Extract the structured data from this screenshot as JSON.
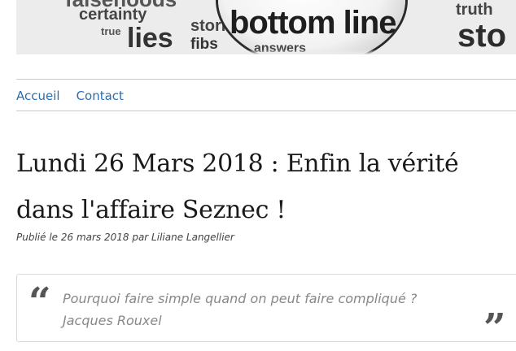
{
  "header": {
    "banner_words": [
      "certainty",
      "true",
      "lies",
      "stories",
      "fibs",
      "answers",
      "bottom line",
      "truth",
      "sto",
      "falsehoods"
    ]
  },
  "nav": {
    "items": [
      {
        "label": "Accueil"
      },
      {
        "label": "Contact"
      }
    ]
  },
  "article": {
    "title_line1": "Lundi 26 Mars 2018 : Enfin la vérité",
    "title_line2": "dans l'affaire Seznec !",
    "meta": "Publié le 26 mars 2018 par Liliane Langellier"
  },
  "quote": {
    "open_mark": "“",
    "close_mark": "”",
    "text": "Pourquoi faire simple quand on peut faire compliqué ?",
    "author": "Jacques Rouxel"
  },
  "colors": {
    "link": "#2a6fb0",
    "title": "#1a1a1a",
    "quote_text": "#888888",
    "quote_mark": "#555555"
  }
}
